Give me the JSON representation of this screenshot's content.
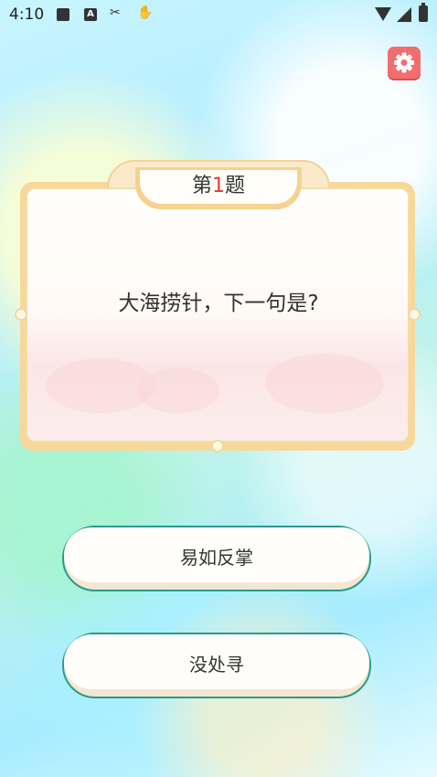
{
  "status_bar": {
    "time": "4:10",
    "icons": [
      "image-icon",
      "a-icon",
      "tools-icon",
      "hand-icon",
      "wifi-icon",
      "signal-icon",
      "battery-icon"
    ]
  },
  "settings": {
    "icon": "gear-icon",
    "color": "#f26e6e"
  },
  "question": {
    "title_prefix": "第",
    "title_number": "1",
    "title_suffix": "题",
    "text": "大海捞针，下一句是?"
  },
  "answers": [
    {
      "label": "易如反掌"
    },
    {
      "label": "没处寻"
    }
  ],
  "colors": {
    "accent_red": "#e53935",
    "button_border": "#2a9a8c",
    "card_frame": "#f6d89a"
  }
}
